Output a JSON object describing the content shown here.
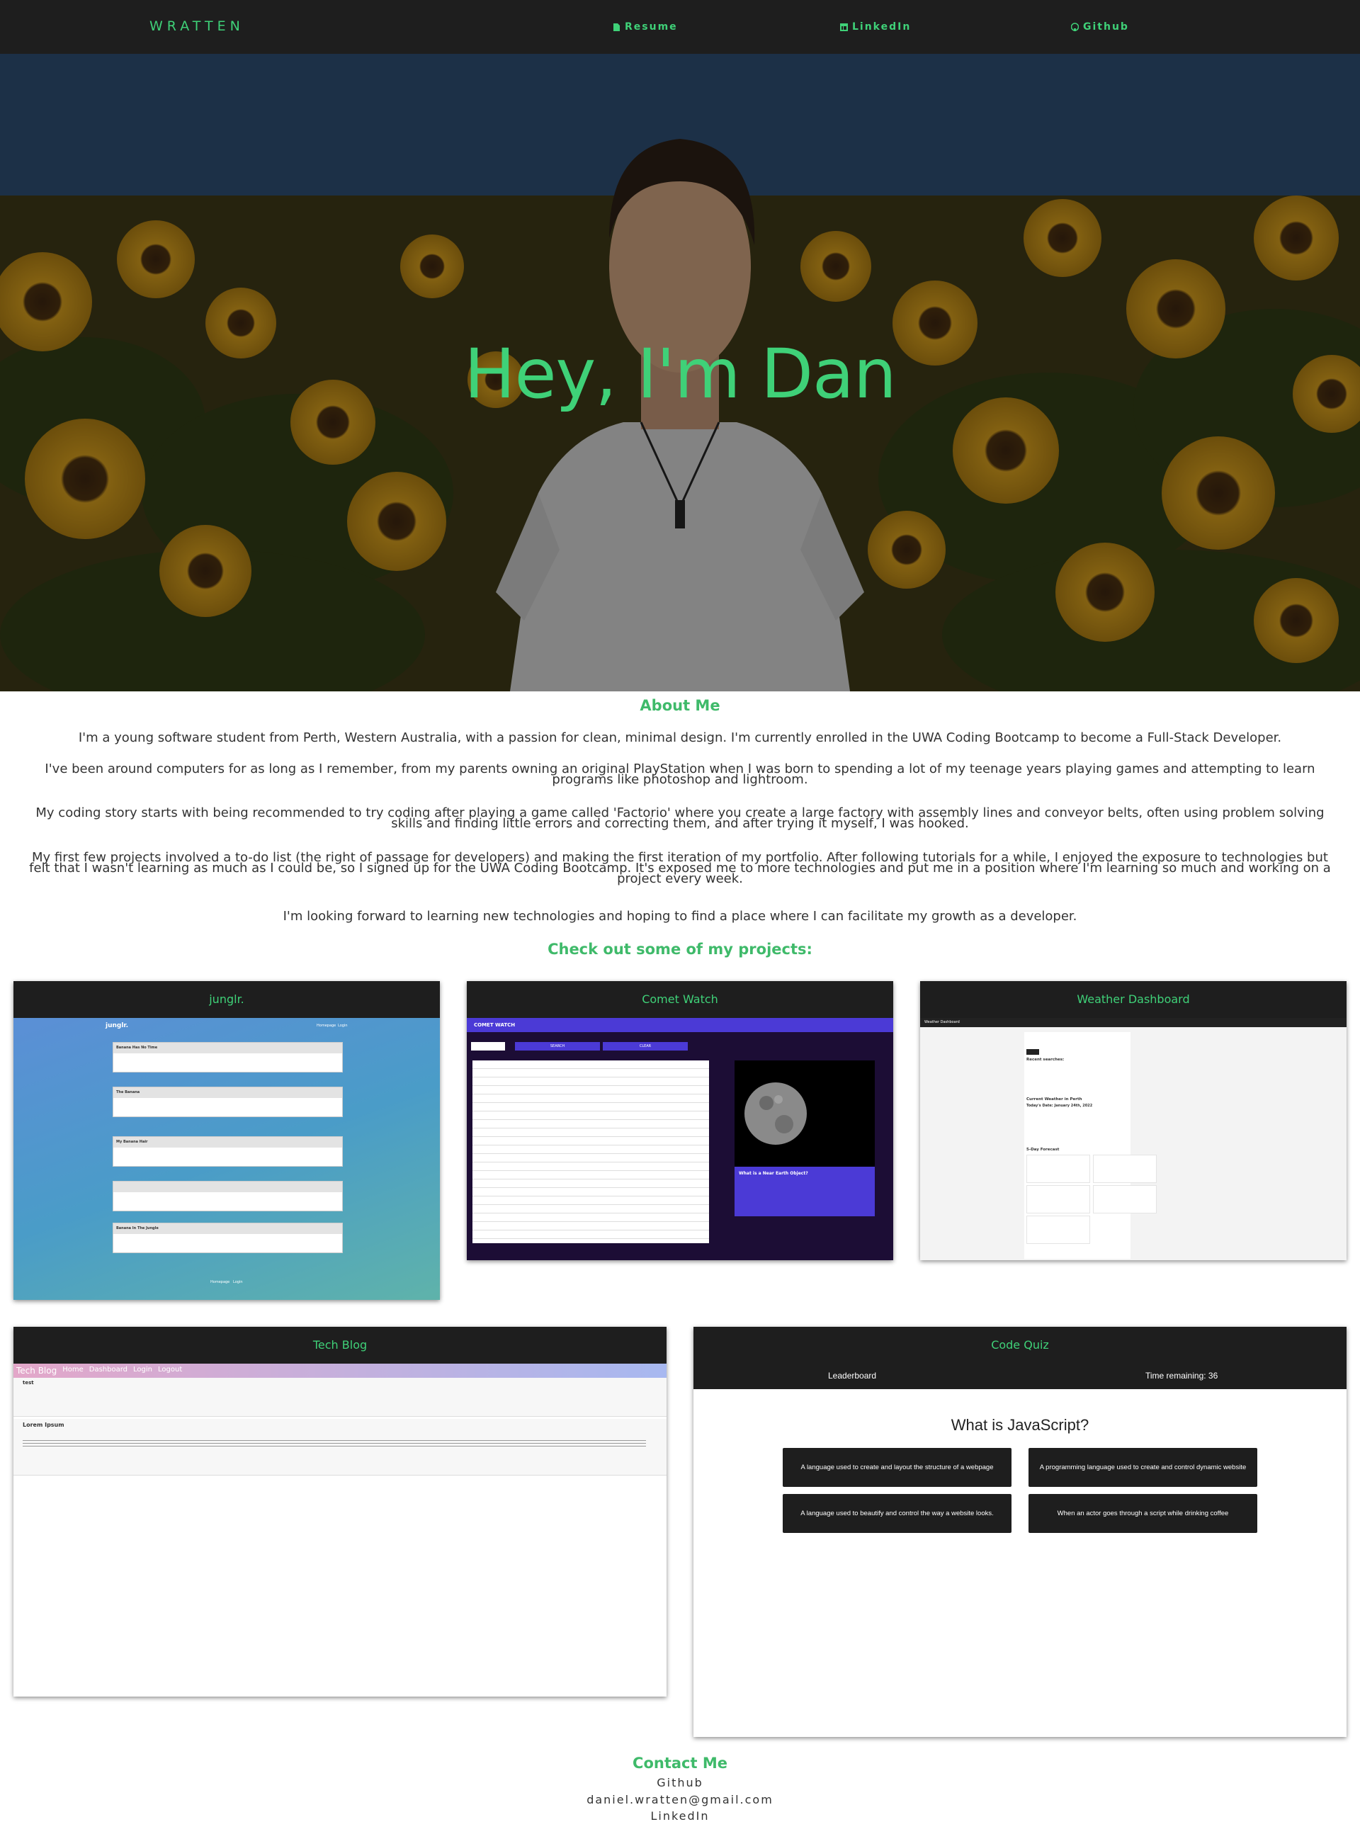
{
  "nav": {
    "brand": "WRATTEN",
    "links": [
      {
        "label": "Resume",
        "icon": "file-icon"
      },
      {
        "label": "LinkedIn",
        "icon": "linkedin-icon"
      },
      {
        "label": "Github",
        "icon": "github-icon"
      }
    ]
  },
  "hero": {
    "title": "Hey, I'm Dan"
  },
  "about": {
    "heading": "About Me",
    "paragraphs": [
      "I'm a young software student from Perth, Western Australia, with a passion for clean, minimal design. I'm currently enrolled in the UWA Coding Bootcamp to become a Full-Stack Developer.",
      "I've been around computers for as long as I remember, from my parents owning an original PlayStation when I was born to spending a lot of my teenage years playing games and attempting to learn programs like photoshop and lightroom.",
      "My coding story starts with being recommended to try coding after playing a game called 'Factorio' where you create a large factory with assembly lines and conveyor belts, often using problem solving skills and finding little errors and correcting them, and after trying it myself, I was hooked.",
      "My first few projects involved a to-do list (the right of passage for developers) and making the first iteration of my portfolio. After following tutorials for a while, I enjoyed the exposure to technologies but felt that I wasn't learning as much as I could be, so I signed up for the UWA Coding Bootcamp. It's exposed me to more technologies and put me in a position where I'm learning so much and working on a project every week.",
      "I'm looking forward to learning new technologies and hoping to find a place where I can facilitate my growth as a developer."
    ]
  },
  "projects": {
    "heading": "Check out some of my projects:",
    "junglr": {
      "title": "junglr.",
      "app_brand": "junglr.",
      "nav": [
        "Homepage",
        "Login"
      ],
      "posts": [
        "Banana Has No Time",
        "The Banana",
        "My Banana Hair",
        "",
        "Banana In The Jungle"
      ],
      "footer": [
        "Homepage",
        "Login"
      ]
    },
    "comet": {
      "title": "Comet Watch",
      "app_header": "COMET WATCH",
      "buttons": [
        "SEARCH",
        "CLEAR"
      ],
      "panel_title": "What is a Near Earth Object?"
    },
    "weather": {
      "title": "Weather Dashboard",
      "app_header": "Weather Dashboard",
      "recent": "Recent searches:",
      "current": "Current Weather in Perth",
      "date": "Today's Date: January 24th, 2022",
      "forecast": "5-Day Forecast"
    },
    "blog": {
      "title": "Tech Blog",
      "app_brand": "Tech Blog",
      "nav": [
        "Home",
        "Dashboard",
        "Login",
        "Logout"
      ],
      "post1_title": "test",
      "post2_title": "Lorem Ipsum"
    },
    "quiz": {
      "title": "Code Quiz",
      "leaderboard": "Leaderboard",
      "timer": "Time remaining: 36",
      "question": "What is JavaScript?",
      "answers": [
        "A language used to create and layout the structure of a webpage",
        "A programming language used to create and control dynamic website content",
        "A language used to beautify and control the way a website looks.",
        "When an actor goes through a script while drinking coffee"
      ]
    }
  },
  "contact": {
    "heading": "Contact Me",
    "items": [
      "Github",
      "daniel.wratten@gmail.com",
      "LinkedIn"
    ]
  },
  "colors": {
    "accent": "#3fd178",
    "nav_bg": "#1e1e1e"
  }
}
